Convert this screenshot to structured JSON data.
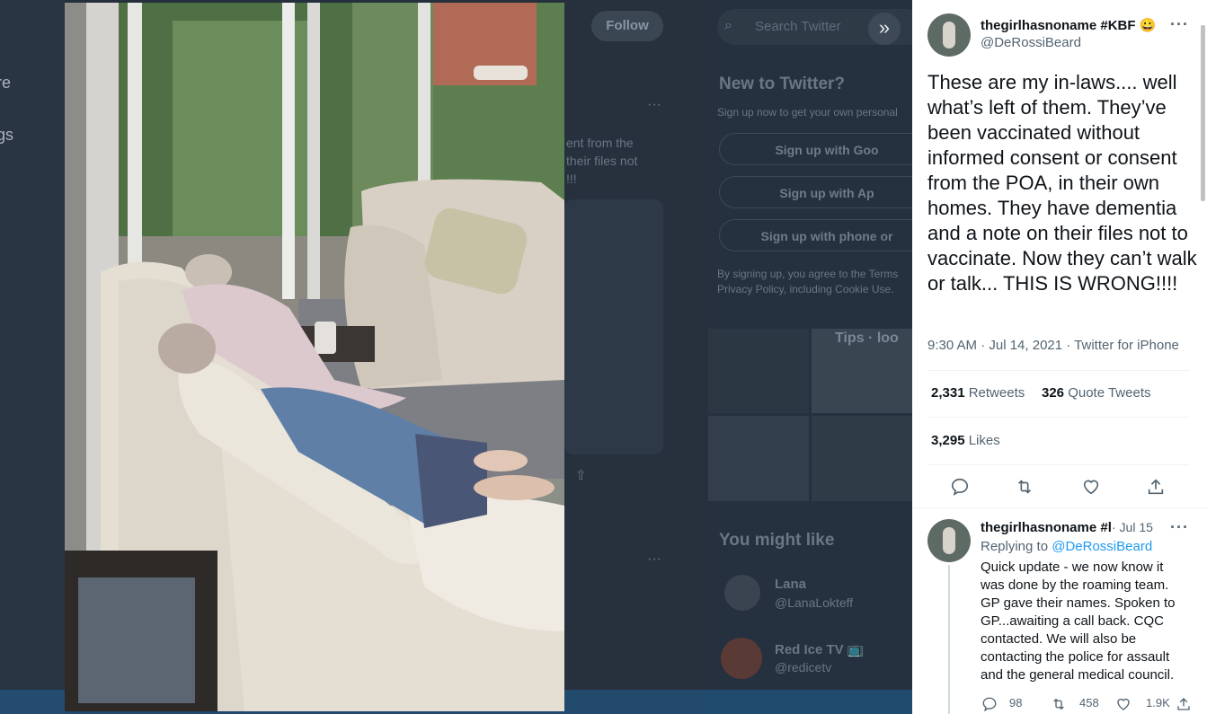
{
  "background": {
    "left_nav": [
      "re",
      "gs"
    ],
    "follow_label": "Follow",
    "search_placeholder": "Search Twitter",
    "snippet": [
      "ent from the",
      "their files not",
      "!!!"
    ],
    "new_to_twitter": "New to Twitter?",
    "signup_sub": "Sign up now to get your own personal",
    "signup_google": "Sign up with Goo",
    "signup_apple": "Sign up with Ap",
    "signup_phone": "Sign up with phone or",
    "terms_1": "By signing up, you agree to the Terms",
    "terms_2": "Privacy Policy, including Cookie Use.",
    "thumb_caption": "Tips · loo",
    "you_might_like": "You might like",
    "suggestions": [
      {
        "name": "Lana",
        "handle": "@LanaLokteff"
      },
      {
        "name": "Red Ice TV 📺",
        "handle": "@redicetv"
      }
    ]
  },
  "tweet": {
    "author_name": "thegirlhasnoname #KBF 😀",
    "author_handle": "@DeRossiBeard",
    "text": "These are my in-laws.... well what’s left of them. They’ve been vaccinated without informed consent or consent from the POA, in their own homes. They have dementia and a note on their files not to vaccinate. Now they can’t walk or talk... THIS IS WRONG!!!!",
    "meta": "9:30 AM · Jul 14, 2021 · Twitter for iPhone",
    "retweets_count": "2,331",
    "retweets_label": "Retweets",
    "quotes_count": "326",
    "quotes_label": "Quote Tweets",
    "likes_count": "3,295",
    "likes_label": "Likes",
    "more_label": "···"
  },
  "reply": {
    "author_name": "thegirlhasnoname #l",
    "date": "· Jul 15",
    "replying_prefix": "Replying to",
    "replying_handle": "@DeRossiBeard",
    "text": "Quick update - we now know it was done by the roaming team. GP gave their names. Spoken to GP...awaiting a call back. CQC contacted. We will also be contacting the police for assault and the general medical council.",
    "replies": "98",
    "retweets": "458",
    "likes": "1.9K"
  },
  "icons": {
    "expand": "»"
  },
  "colors": {
    "link": "#1d9bf0",
    "secondary_text": "#536471",
    "overlay": "#26303c"
  }
}
